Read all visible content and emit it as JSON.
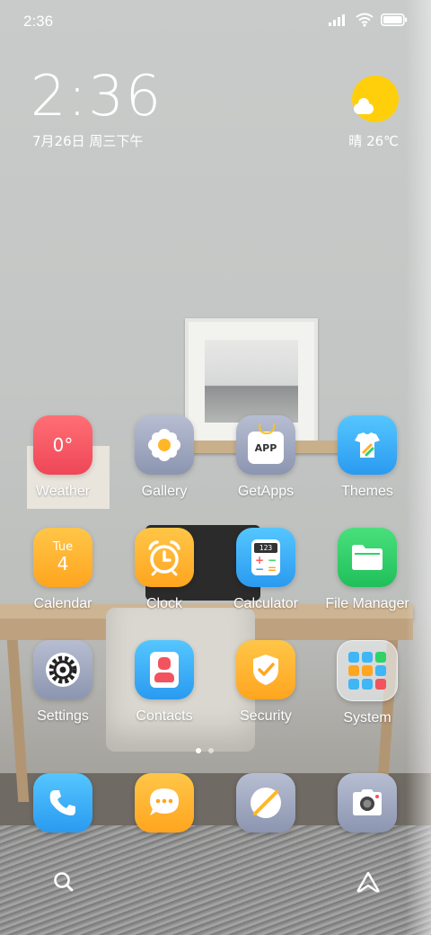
{
  "status_bar": {
    "time": "2:36"
  },
  "clock_widget": {
    "time": "2:36",
    "date": "7月26日 周三下午"
  },
  "weather_widget": {
    "text": "晴 26℃",
    "sun_color": "#ffcf0c"
  },
  "apps": [
    {
      "label": "Weather",
      "icon_text": "0°",
      "icon": "weather-icon",
      "color": "#f2535e"
    },
    {
      "label": "Gallery",
      "icon": "gallery-flower-icon",
      "color": "#9aa3bd"
    },
    {
      "label": "GetApps",
      "icon_text": "APP",
      "icon": "getapps-bag-icon",
      "color": "#9aa3bd"
    },
    {
      "label": "Themes",
      "icon": "themes-shirt-icon",
      "color": "#3fb6f5"
    },
    {
      "label": "Calendar",
      "icon_day": "Tue",
      "icon_date": "4",
      "icon": "calendar-icon",
      "color": "#ffb12d"
    },
    {
      "label": "Clock",
      "icon": "alarm-clock-icon",
      "color": "#ffae2b"
    },
    {
      "label": "Calculator",
      "icon_text": "123",
      "icon": "calculator-icon",
      "color": "#3fb6f5"
    },
    {
      "label": "File Manager",
      "icon": "folder-icon",
      "color": "#2fd267"
    },
    {
      "label": "Settings",
      "icon": "gear-icon",
      "color": "#9aa3bd"
    },
    {
      "label": "Contacts",
      "icon": "contact-person-icon",
      "color": "#3fb6f5"
    },
    {
      "label": "Security",
      "icon": "shield-check-icon",
      "color": "#ffae2b"
    },
    {
      "label": "System",
      "icon": "folder-grid-icon",
      "color": "#c8ccd0"
    }
  ],
  "dock": [
    {
      "icon": "phone-icon",
      "color": "#3fb6f5"
    },
    {
      "icon": "messages-icon",
      "color": "#ffae2b"
    },
    {
      "icon": "browser-compass-icon",
      "color": "#9aa3bd"
    },
    {
      "icon": "camera-icon",
      "color": "#9aa3bd"
    }
  ],
  "page_indicator": {
    "pages": 2,
    "active": 1
  }
}
